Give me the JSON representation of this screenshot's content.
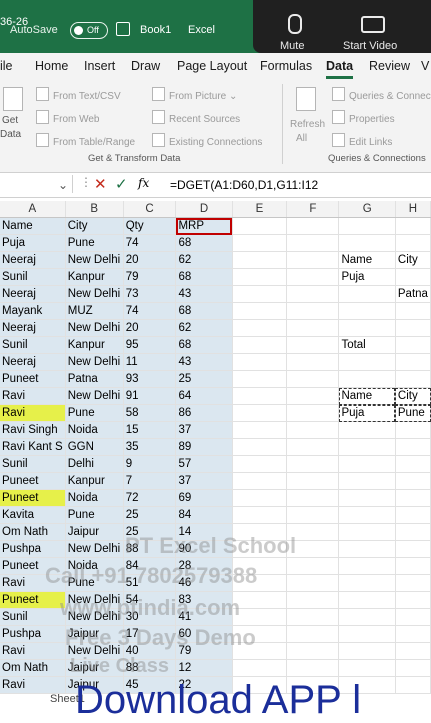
{
  "titlebar": {
    "time": "36-26",
    "autosave_label": "AutoSave",
    "autosave_state": "Off",
    "book_name": "Book1",
    "app_name": "Excel",
    "accent_color": "#1e7145"
  },
  "recorder": {
    "mute_label": "Mute",
    "start_label": "Start Video"
  },
  "menu": [
    "ile",
    "Home",
    "Insert",
    "Draw",
    "Page Layout",
    "Formulas",
    "Data",
    "Review",
    "V"
  ],
  "ribbon": {
    "get_data": "Get",
    "get_data2": "Data",
    "from_text_csv": "From Text/CSV",
    "from_web": "From Web",
    "from_table_range": "From Table/Range",
    "from_picture": "From Picture",
    "recent_sources": "Recent Sources",
    "existing_connections": "Existing Connections",
    "group_get_transform": "Get & Transform Data",
    "refresh": "Refresh",
    "refresh_all": "All",
    "queries_connections": "Queries & Connec",
    "properties": "Properties",
    "edit_links": "Edit Links",
    "group_queries": "Queries & Connections"
  },
  "formula_bar": {
    "cancel": "✕",
    "enter": "✓",
    "fx": "fx",
    "formula": "=DGET(A1:D60,D1,G11:I12"
  },
  "columns": [
    "A",
    "B",
    "C",
    "D",
    "E",
    "F",
    "G",
    "H"
  ],
  "rows": [
    [
      "Name",
      "City",
      "Qty",
      "MRP",
      "",
      "",
      "",
      ""
    ],
    [
      "Puja",
      "Pune",
      "74",
      "68",
      "",
      "",
      "",
      ""
    ],
    [
      "Neeraj",
      "New Delhi",
      "20",
      "62",
      "",
      "",
      "Name",
      "City"
    ],
    [
      "Sunil",
      "Kanpur",
      "79",
      "68",
      "",
      "",
      "Puja",
      ""
    ],
    [
      "Neeraj",
      "New Delhi",
      "73",
      "43",
      "",
      "",
      "",
      "Patna"
    ],
    [
      "Mayank",
      "MUZ",
      "74",
      "68",
      "",
      "",
      "",
      ""
    ],
    [
      "Neeraj",
      "New Delhi",
      "20",
      "62",
      "",
      "",
      "",
      ""
    ],
    [
      "Sunil",
      "Kanpur",
      "95",
      "68",
      "",
      "",
      "Total",
      ""
    ],
    [
      "Neeraj",
      "New Delhi",
      "11",
      "43",
      "",
      "",
      "",
      ""
    ],
    [
      "Puneet",
      "Patna",
      "93",
      "25",
      "",
      "",
      "",
      ""
    ],
    [
      "Ravi",
      "New Delhi",
      "91",
      "64",
      "",
      "",
      "Name",
      "City"
    ],
    [
      "Ravi",
      "Pune",
      "58",
      "86",
      "",
      "",
      "Puja",
      "Pune"
    ],
    [
      "Ravi Singh",
      "Noida",
      "15",
      "37",
      "",
      "",
      "",
      ""
    ],
    [
      "Ravi Kant S",
      "GGN",
      "35",
      "89",
      "",
      "",
      "",
      ""
    ],
    [
      "Sunil",
      "Delhi",
      "9",
      "57",
      "",
      "",
      "",
      ""
    ],
    [
      "Puneet",
      "Kanpur",
      "7",
      "37",
      "",
      "",
      "",
      ""
    ],
    [
      "Puneet",
      "Noida",
      "72",
      "69",
      "",
      "",
      "",
      ""
    ],
    [
      "Kavita",
      "Pune",
      "25",
      "84",
      "",
      "",
      "",
      ""
    ],
    [
      "Om Nath",
      "Jaipur",
      "25",
      "14",
      "",
      "",
      "",
      ""
    ],
    [
      "Pushpa",
      "New Delhi",
      "88",
      "90",
      "",
      "",
      "",
      ""
    ],
    [
      "Puneet",
      "Noida",
      "84",
      "28",
      "",
      "",
      "",
      ""
    ],
    [
      "Ravi",
      "Pune",
      "51",
      "46",
      "",
      "",
      "",
      ""
    ],
    [
      "Puneet",
      "New Delhi",
      "54",
      "83",
      "",
      "",
      "",
      ""
    ],
    [
      "Sunil",
      "New Delhi",
      "30",
      "41",
      "",
      "",
      "",
      ""
    ],
    [
      "Pushpa",
      "Jaipur",
      "17",
      "60",
      "",
      "",
      "",
      ""
    ],
    [
      "Ravi",
      "New Delhi",
      "40",
      "79",
      "",
      "",
      "",
      ""
    ],
    [
      "Om Nath",
      "Jaipur",
      "88",
      "12",
      "",
      "",
      "",
      ""
    ],
    [
      "Ravi",
      "Jaipur",
      "45",
      "22",
      "",
      "",
      "",
      ""
    ]
  ],
  "highlight_color": "#e6f04a",
  "sheet_tab": "Sheet1",
  "watermark": {
    "line1": "PT Excel School",
    "line2": "Call +91 7802579388",
    "line3": "www.ptindia.com",
    "line4": "Free 3 Days Demo",
    "line5": "Live Class",
    "download": "Download APP l"
  }
}
